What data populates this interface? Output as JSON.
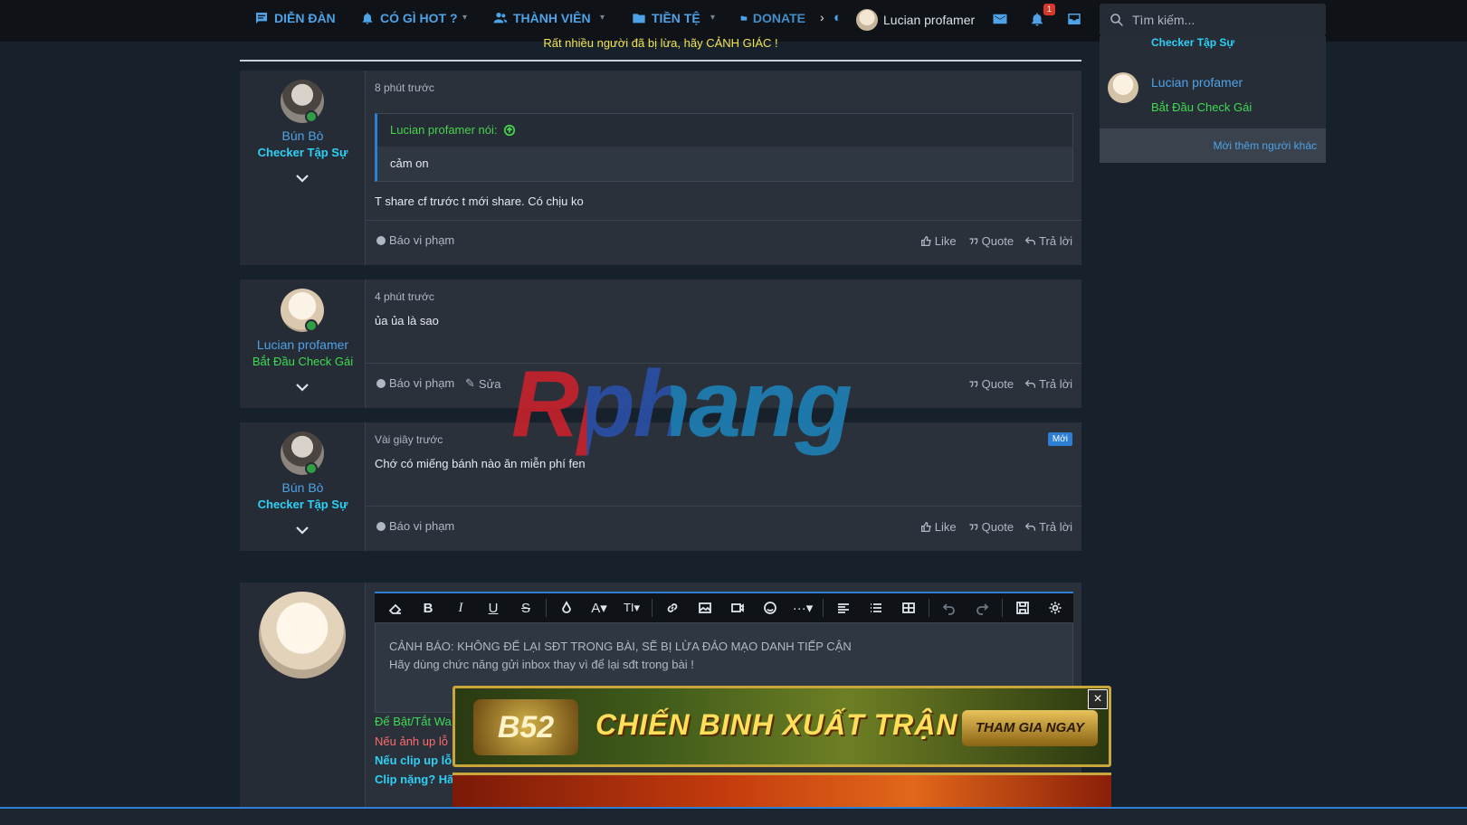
{
  "nav": {
    "items": [
      {
        "label": "DIỄN ĐÀN",
        "icon": "forum-icon"
      },
      {
        "label": "CÓ GÌ HOT ?",
        "icon": "bell-icon"
      },
      {
        "label": "THÀNH VIÊN",
        "icon": "users-icon"
      },
      {
        "label": "TIỀN TỆ",
        "icon": "folder-icon"
      },
      {
        "label": "DONATE",
        "icon": "folder-icon"
      }
    ],
    "user": "Lucian profamer",
    "notification_count": "1",
    "search_placeholder": "Tìm kiếm..."
  },
  "notice": "Rất nhiều người đã bị lừa, hãy CẢNH GIÁC !",
  "sidebar": {
    "top_rank": "Checker Tập Sự",
    "member_name": "Lucian profamer",
    "member_rank": "Bắt Đầu Check Gái",
    "invite_link": "Mời thêm người khác"
  },
  "posts": [
    {
      "author": "Bún Bò",
      "rank": "Checker Tập Sự",
      "time": "8 phút trước",
      "quote_author": "Lucian profamer nói:",
      "quote_text": "cảm on",
      "body": "T share cf trước t mới share. Có chịu ko",
      "report": "Báo vi phạm",
      "actions": [
        "Like",
        "Quote",
        "Trả lời"
      ]
    },
    {
      "author": "Lucian profamer",
      "rank": "Bắt Đầu Check Gái",
      "time": "4 phút trước",
      "body": "ủa ủa là sao",
      "report": "Báo vi phạm",
      "edit": "Sửa",
      "actions": [
        "Quote",
        "Trả lời"
      ]
    },
    {
      "author": "Bún Bò",
      "rank": "Checker Tập Sự",
      "time": "Vài giây trước",
      "badge": "Mới",
      "body": "Chớ có miếng bánh nào ăn miễn phí fen",
      "report": "Báo vi phạm",
      "actions": [
        "Like",
        "Quote",
        "Trả lời"
      ]
    }
  ],
  "reply": {
    "placeholder_line1": "CẢNH BÁO: KHÔNG ĐỂ LẠI SĐT TRONG BÀI, SẼ BỊ LỪA ĐẢO MẠO DANH TIẾP CẬN",
    "placeholder_line2": "Hãy dùng chức năng gửi inbox thay vì để lại sđt trong bài !",
    "hints": [
      "Để Bật/Tắt Wa",
      "Nếu ảnh up lỗ",
      "Nếu clip up lỗ",
      "Clip nặng? Hã"
    ]
  },
  "watermark": "Rphang",
  "ad": {
    "logo": "B52",
    "title": "CHIẾN BINH XUẤT TRẬN",
    "cta": "THAM GIA NGAY"
  },
  "colors": {
    "accent": "#4ea3e8",
    "rank_cyan": "#2ed0f5",
    "rank_green": "#3ddb52",
    "background": "#17212c"
  }
}
